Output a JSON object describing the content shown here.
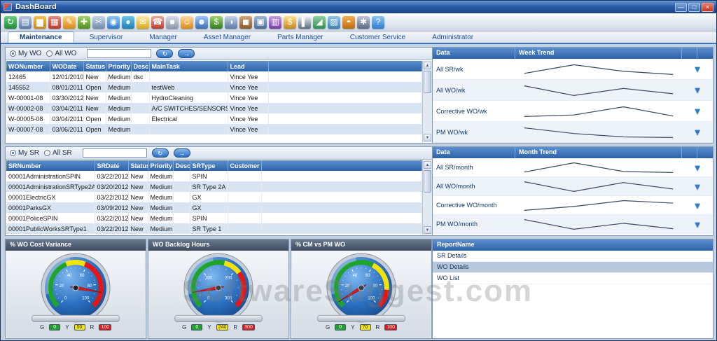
{
  "window": {
    "title": "DashBoard"
  },
  "titlebar": {
    "minimize_glyph": "—",
    "maximize_glyph": "□",
    "close_glyph": "×"
  },
  "toolbar": {
    "icons": [
      {
        "name": "refresh-icon",
        "glyph": "↻",
        "c1": "#6fd07e",
        "c2": "#1f8a37"
      },
      {
        "name": "report-icon",
        "glyph": "▤",
        "c1": "#b8c8e0",
        "c2": "#5a7aa8"
      },
      {
        "name": "chart-bar-icon",
        "glyph": "▆",
        "c1": "#f2c14e",
        "c2": "#c9881a"
      },
      {
        "name": "calendar-icon",
        "glyph": "▦",
        "c1": "#ef8a80",
        "c2": "#b5392c"
      },
      {
        "name": "edit-icon",
        "glyph": "✎",
        "c1": "#ffd27a",
        "c2": "#d98719"
      },
      {
        "name": "tools-icon",
        "glyph": "✚",
        "c1": "#9fd468",
        "c2": "#4e8f1e"
      },
      {
        "name": "cut-icon",
        "glyph": "✂",
        "c1": "#c9d6ea",
        "c2": "#7189ad"
      },
      {
        "name": "search-icon",
        "glyph": "◉",
        "c1": "#8ec6f0",
        "c2": "#2d7dd2"
      },
      {
        "name": "globe-icon",
        "glyph": "●",
        "c1": "#6fc7e8",
        "c2": "#1a7fb5"
      },
      {
        "name": "mail-icon",
        "glyph": "✉",
        "c1": "#ffe9a0",
        "c2": "#d9a919"
      },
      {
        "name": "phone-icon",
        "glyph": "☎",
        "c1": "#f0a9a0",
        "c2": "#bd3a2a"
      },
      {
        "name": "print-icon",
        "glyph": "■",
        "c1": "#d8dee8",
        "c2": "#8a96a8"
      },
      {
        "name": "user-icon",
        "glyph": "☺",
        "c1": "#ffd9a0",
        "c2": "#d98719"
      },
      {
        "name": "users-icon",
        "glyph": "☻",
        "c1": "#a0c8ff",
        "c2": "#3a6fb0"
      },
      {
        "name": "money-icon",
        "glyph": "$",
        "c1": "#9fd468",
        "c2": "#2e7d1e"
      },
      {
        "name": "clock-icon",
        "glyph": "◑",
        "c1": "#c8d4e8",
        "c2": "#5a7aa8"
      },
      {
        "name": "package-icon",
        "glyph": "◼",
        "c1": "#d2a679",
        "c2": "#8a5a2b"
      },
      {
        "name": "truck-icon",
        "glyph": "▣",
        "c1": "#9fb8d8",
        "c2": "#4a6a96"
      },
      {
        "name": "book-icon",
        "glyph": "▥",
        "c1": "#c8a2e0",
        "c2": "#7a3aa8"
      },
      {
        "name": "dollar-icon",
        "glyph": "$",
        "c1": "#ffe08a",
        "c2": "#c9881a"
      },
      {
        "name": "barcode-icon",
        "glyph": "▌",
        "c1": "#f0f2f6",
        "c2": "#5a6b80"
      },
      {
        "name": "chart-line-icon",
        "glyph": "◢",
        "c1": "#8ed0a0",
        "c2": "#2e8f4e"
      },
      {
        "name": "photo-icon",
        "glyph": "▨",
        "c1": "#90c8e8",
        "c2": "#3a80b0"
      },
      {
        "name": "gauge-icon",
        "glyph": "◓",
        "c1": "#f2b04e",
        "c2": "#c06a10"
      },
      {
        "name": "settings-icon",
        "glyph": "✱",
        "c1": "#c0c8d8",
        "c2": "#5a6880"
      },
      {
        "name": "help-icon",
        "glyph": "?",
        "c1": "#8ec6f0",
        "c2": "#2d7dd2"
      }
    ]
  },
  "tabs": {
    "items": [
      {
        "label": "Maintenance",
        "active": true
      },
      {
        "label": "Supervisor",
        "active": false
      },
      {
        "label": "Manager",
        "active": false
      },
      {
        "label": "Asset Manager",
        "active": false
      },
      {
        "label": "Parts Manager",
        "active": false
      },
      {
        "label": "Customer Service",
        "active": false
      },
      {
        "label": "Administrator",
        "active": false
      }
    ]
  },
  "grid_buttons": {
    "refresh_glyph": "↻",
    "go_glyph": "→"
  },
  "wo_panel": {
    "radios": [
      {
        "label": "My WO",
        "selected": true
      },
      {
        "label": "All WO",
        "selected": false
      }
    ],
    "search_value": "",
    "grid": {
      "columns": [
        "WONumber",
        "WODate",
        "Status",
        "Priority",
        "Desc",
        "MainTask",
        "Lead"
      ],
      "rows": [
        [
          "12465",
          "12/01/2010",
          "New",
          "Medium",
          "dsc",
          "",
          "Vince Yee"
        ],
        [
          "145552",
          "08/01/2011",
          "Open",
          "Medium",
          "",
          "testWeb",
          "Vince Yee"
        ],
        [
          "W-00001-08",
          "03/30/2012",
          "New",
          "Medium",
          "",
          "HydroCleaning",
          "Vince Yee"
        ],
        [
          "W-00002-08",
          "03/04/2011",
          "New",
          "Medium",
          "",
          "A/C SWITCHES/SENSORS",
          "Vince Yee"
        ],
        [
          "W-00005-08",
          "03/04/2011",
          "Open",
          "Medium",
          "",
          "Electrical",
          "Vince Yee"
        ],
        [
          "W-00007-08",
          "03/06/2011",
          "Open",
          "Medium",
          "",
          "",
          "Vince Yee"
        ]
      ]
    }
  },
  "sr_panel": {
    "radios": [
      {
        "label": "My SR",
        "selected": true
      },
      {
        "label": "All SR",
        "selected": false
      }
    ],
    "search_value": "",
    "grid": {
      "columns": [
        "SRNumber",
        "SRDate",
        "Status",
        "Priority",
        "Desc",
        "SRType",
        "Customer"
      ],
      "rows": [
        [
          "00001AdministrationSPIN",
          "03/22/2012",
          "New",
          "Medium",
          "",
          "SPIN",
          ""
        ],
        [
          "00001AdministrationSRType2A",
          "03/20/2012",
          "New",
          "Medium",
          "",
          "SR Type 2A",
          ""
        ],
        [
          "00001ElectricGX",
          "03/22/2012",
          "New",
          "Medium",
          "",
          "GX",
          ""
        ],
        [
          "00001ParksGX",
          "03/09/2012",
          "New",
          "Medium",
          "",
          "GX",
          ""
        ],
        [
          "00001PoliceSPIN",
          "03/22/2012",
          "New",
          "Medium",
          "",
          "SPIN",
          ""
        ],
        [
          "00001PublicWorksSRType1",
          "03/22/2012",
          "New",
          "Medium",
          "",
          "SR Type 1",
          ""
        ]
      ]
    }
  },
  "week_trend": {
    "header": {
      "col1": "Data",
      "col2": "Week Trend"
    },
    "rows": [
      {
        "label": "All SR/wk",
        "spark": [
          1.2,
          2.8,
          1.6,
          1.0
        ]
      },
      {
        "label": "All WO/wk",
        "spark": [
          2.4,
          1.3,
          2.1,
          1.5
        ]
      },
      {
        "label": "Corrective WO/wk",
        "spark": [
          1.0,
          1.3,
          2.9,
          1.1
        ]
      },
      {
        "label": "PM WO/wk",
        "spark": [
          2.8,
          1.8,
          1.2,
          1.1
        ]
      }
    ]
  },
  "month_trend": {
    "header": {
      "col1": "Data",
      "col2": "Month Trend"
    },
    "rows": [
      {
        "label": "All SR/month",
        "spark": [
          1.0,
          2.9,
          1.1,
          0.9
        ]
      },
      {
        "label": "All WO/month",
        "spark": [
          2.1,
          0.9,
          2.0,
          1.2
        ]
      },
      {
        "label": "Corrective WO/month",
        "spark": [
          0.8,
          1.6,
          2.8,
          2.3
        ]
      },
      {
        "label": "PM WO/month",
        "spark": [
          2.7,
          0.9,
          2.0,
          1.0
        ]
      }
    ]
  },
  "reports": {
    "header": "ReportName",
    "items": [
      {
        "label": "SR Details",
        "selected": false
      },
      {
        "label": "WO Details",
        "selected": true
      },
      {
        "label": "WO List",
        "selected": false
      }
    ]
  },
  "chart_data": [
    {
      "type": "gauge",
      "title": "% WO Cost Variance",
      "min": 0,
      "max": 100,
      "ticks": [
        "0",
        "20",
        "40",
        "60",
        "80",
        "100"
      ],
      "segments": [
        {
          "color": "#1fa32e",
          "from": 0.0,
          "to": 0.42
        },
        {
          "color": "#f5e400",
          "from": 0.42,
          "to": 0.58
        },
        {
          "color": "#e01818",
          "from": 0.58,
          "to": 1.0
        }
      ],
      "needle": 0.87,
      "legend": [
        {
          "label": "G",
          "value": "0",
          "color": "#1fa32e",
          "tc": "#ffffff"
        },
        {
          "label": "Y",
          "value": "50",
          "color": "#f5e400",
          "tc": "#333333"
        },
        {
          "label": "R",
          "value": "100",
          "color": "#e01818",
          "tc": "#ffffff"
        }
      ]
    },
    {
      "type": "gauge",
      "title": "WO Backlog Hours",
      "min": 0,
      "max": 300,
      "ticks": [
        "0",
        "100",
        "200",
        "300"
      ],
      "segments": [
        {
          "color": "#1fa32e",
          "from": 0.0,
          "to": 0.55
        },
        {
          "color": "#f5e400",
          "from": 0.55,
          "to": 0.7
        },
        {
          "color": "#e01818",
          "from": 0.7,
          "to": 1.0
        }
      ],
      "needle": 0.13,
      "legend": [
        {
          "label": "G",
          "value": "0",
          "color": "#1fa32e",
          "tc": "#ffffff"
        },
        {
          "label": "Y",
          "value": "240",
          "color": "#f5e400",
          "tc": "#333333"
        },
        {
          "label": "R",
          "value": "300",
          "color": "#e01818",
          "tc": "#ffffff"
        }
      ]
    },
    {
      "type": "gauge",
      "title": "% CM vs PM WO",
      "min": 0,
      "max": 100,
      "ticks": [
        "0",
        "20",
        "40",
        "60",
        "80",
        "100"
      ],
      "segments": [
        {
          "color": "#1fa32e",
          "from": 0.0,
          "to": 0.6
        },
        {
          "color": "#f5e400",
          "from": 0.6,
          "to": 0.85
        },
        {
          "color": "#e01818",
          "from": 0.85,
          "to": 1.0
        }
      ],
      "needle": 0.05,
      "legend": [
        {
          "label": "G",
          "value": "0",
          "color": "#1fa32e",
          "tc": "#ffffff"
        },
        {
          "label": "Y",
          "value": "70",
          "color": "#f5e400",
          "tc": "#333333"
        },
        {
          "label": "R",
          "value": "100",
          "color": "#e01818",
          "tc": "#ffffff"
        }
      ]
    }
  ],
  "watermark": "SoftwareSuggest.com",
  "colors": {
    "spark": "#3d4a63",
    "arrow_blue": "#2b7cd3",
    "accent": "#2e62a8"
  }
}
